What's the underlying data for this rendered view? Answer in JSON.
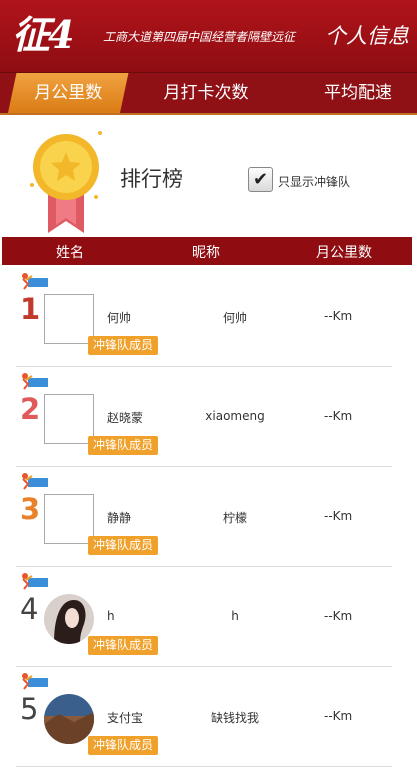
{
  "header": {
    "logo": "征4",
    "subtitle": "工商大道第四届中国经营者隔壁远征",
    "profile_label": "个人信息"
  },
  "tabs": [
    {
      "label": "月公里数",
      "active": true
    },
    {
      "label": "月打卡次数",
      "active": false
    },
    {
      "label": "平均配速",
      "active": false
    }
  ],
  "ranking": {
    "title": "排行榜",
    "filter_label": "只显示冲锋队",
    "filter_checked": true
  },
  "table": {
    "headers": [
      "姓名",
      "昵称",
      "月公里数"
    ],
    "rows": [
      {
        "rank": "1",
        "name": "何帅",
        "nickname": "何帅",
        "km": "--Km",
        "badge": "冲锋队成员",
        "avatar": "broken-image"
      },
      {
        "rank": "2",
        "name": "赵晓蒙",
        "nickname": "xiaomeng",
        "km": "--Km",
        "badge": "冲锋队成员",
        "avatar": "broken-image"
      },
      {
        "rank": "3",
        "name": "静静",
        "nickname": "柠檬",
        "km": "--Km",
        "badge": "冲锋队成员",
        "avatar": "broken-image"
      },
      {
        "rank": "4",
        "name": "h",
        "nickname": "h",
        "km": "--Km",
        "badge": "冲锋队成员",
        "avatar": "photo-woman"
      },
      {
        "rank": "5",
        "name": "支付宝",
        "nickname": "缺钱找我",
        "km": "--Km",
        "badge": "冲锋队成员",
        "avatar": "photo-landscape"
      }
    ]
  },
  "colors": {
    "header_red": "#a0121a",
    "tab_active_orange": "#e8912a",
    "badge_orange": "#f0a12b",
    "rank1": "#c0392b",
    "rank2": "#e05a5a",
    "rank3": "#e8822a",
    "rank_other": "#444444"
  }
}
